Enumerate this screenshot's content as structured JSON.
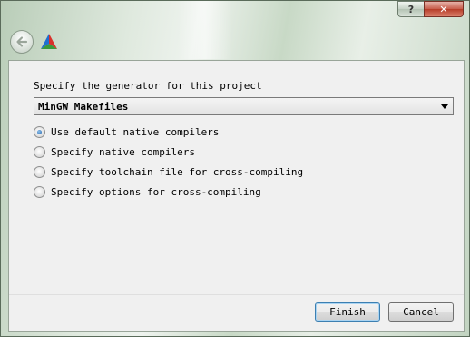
{
  "window": {
    "help_label": "?",
    "close_label": "✕"
  },
  "header": {
    "back_icon": "back-arrow-icon",
    "app_icon": "cmake-triangle-icon"
  },
  "form": {
    "generator_prompt": "Specify the generator for this project",
    "generator_selected": "MinGW Makefiles",
    "options": [
      {
        "label": "Use default native compilers",
        "checked": true
      },
      {
        "label": "Specify native compilers",
        "checked": false
      },
      {
        "label": "Specify toolchain file for cross-compiling",
        "checked": false
      },
      {
        "label": "Specify options for cross-compiling",
        "checked": false
      }
    ]
  },
  "footer": {
    "finish_label": "Finish",
    "cancel_label": "Cancel"
  }
}
